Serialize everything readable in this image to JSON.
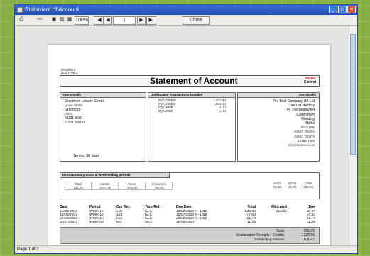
{
  "window": {
    "title": "Statement of Account"
  },
  "toolbar": {
    "zoom": "100%",
    "page_field": "1",
    "close_label": "Close",
    "nav_first": "|◀",
    "nav_prev": "◀",
    "nav_next": "▶",
    "nav_last": "▶|"
  },
  "statusbar": {
    "text": "Page 1 of 1"
  },
  "report": {
    "title": "Statement of Account",
    "company_small": [
      "Grantham",
      "Head Office"
    ],
    "logo": [
      "Bueno",
      "Central"
    ],
    "your_details_label": "Your Details",
    "unallocated_label": "Unallocated Transactions Detailed",
    "our_details_label": "Our Details",
    "your_details": [
      "Grantham Leisure Centre",
      "Union Street",
      "Grantham",
      "Lincs",
      "NG31 6NZ",
      "01476 406187"
    ],
    "terms": "Terms:  30 days",
    "unallocated_lines": [
      {
        "label": "By Cheque",
        "value": "1123.45"
      },
      {
        "label": "By Cheque",
        "value": "300.00"
      },
      {
        "label": "By Credit",
        "value": "0.00"
      },
      {
        "label": "By Credit",
        "value": "0.00"
      }
    ],
    "our_details": [
      "The Best Company UK Ltd",
      "The Old Rectory",
      "44 The Boulevard",
      "Caversham",
      "Reading",
      "Berks",
      "RG1 1BB",
      "01483 750301",
      "01483 750478",
      "10484 1960",
      "info@bestco.co.uk"
    ],
    "debt_summary_label": "Debt summary totals & Week-ending periods",
    "debt_cols": [
      "Total",
      "Unalloc",
      "Week",
      "Elsewhere"
    ],
    "debt_vals": [
      "146.46",
      "1227.56",
      "-800.00",
      "-80.00"
    ],
    "week_heads": [
      "16/07",
      "27/06",
      "27/06"
    ],
    "week_vals": [
      "21.45",
      "51.73",
      "150.84"
    ],
    "table_heads": [
      "Date",
      "Period",
      "Our Ref.",
      "Your Ref.",
      "Due Date",
      "Total",
      "Allocated",
      "Due"
    ],
    "rows": [
      [
        "11/08/2003",
        "Week 12",
        "206",
        "GLC",
        "18/08/2003 <-- Due",
        "538.90",
        "512.56",
        "25.44"
      ],
      [
        "15/08/2003",
        "Week 12",
        "129",
        "GLC",
        "15/07/2003 <-- Due",
        "77.50",
        "",
        "77.50"
      ],
      [
        "27/06/2003",
        "Week 10",
        "662",
        "GLC",
        "26/06/2003 <-- Due",
        "51.74",
        "",
        "51.74"
      ],
      [
        "11/07/2003",
        "Week 09",
        "607",
        "GLC",
        "18/08/2003",
        "11.56",
        "",
        "11.56"
      ]
    ],
    "totals": {
      "total_label": "Total:",
      "total_value": "206.35",
      "unalloc_label": "Unallocated Receipts / Credits:",
      "unalloc_value": "-1227.56",
      "outstanding_label": "Outstanding Balance:",
      "outstanding_value": "1011.47"
    }
  }
}
